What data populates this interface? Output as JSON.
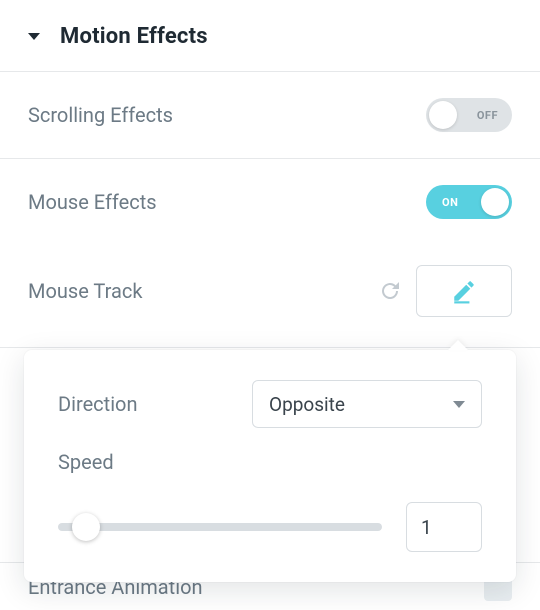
{
  "section": {
    "title": "Motion Effects"
  },
  "scrolling_effects": {
    "label": "Scrolling Effects",
    "state": "OFF"
  },
  "mouse_effects": {
    "label": "Mouse Effects",
    "state": "ON"
  },
  "mouse_track": {
    "label": "Mouse Track"
  },
  "popover": {
    "direction": {
      "label": "Direction",
      "value": "Opposite"
    },
    "speed": {
      "label": "Speed",
      "value": "1"
    }
  },
  "next_row": {
    "label": "Entrance Animation"
  },
  "colors": {
    "accent": "#58d0e0"
  }
}
